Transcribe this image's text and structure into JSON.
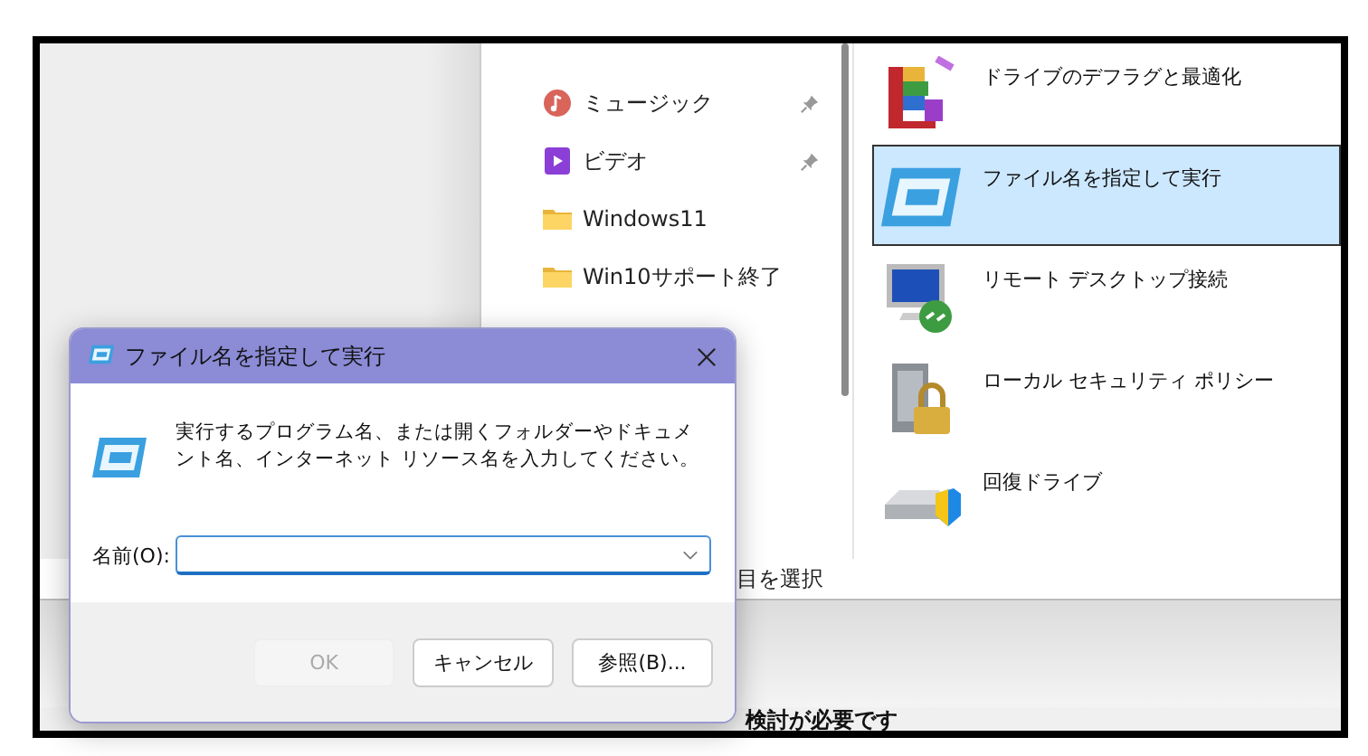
{
  "explorer": {
    "nav_items": [
      {
        "label": "ミュージック",
        "kind": "music",
        "pinned": true
      },
      {
        "label": "ビデオ",
        "kind": "video",
        "pinned": true
      },
      {
        "label": "Windows11",
        "kind": "folder",
        "pinned": false
      },
      {
        "label": "Win10サポート終了",
        "kind": "folder",
        "pinned": false
      }
    ],
    "apps": [
      {
        "label": "ドライブのデフラグと最適化",
        "kind": "defrag",
        "selected": false
      },
      {
        "label": "ファイル名を指定して実行",
        "kind": "run",
        "selected": true
      },
      {
        "label": "リモート デスクトップ接続",
        "kind": "remote",
        "selected": false
      },
      {
        "label": "ローカル セキュリティ ポリシー",
        "kind": "security",
        "selected": false
      },
      {
        "label": "回復ドライブ",
        "kind": "recovery",
        "selected": false
      }
    ],
    "status_text": "目を選択",
    "bottom_text": "検討が必要です"
  },
  "run_dialog": {
    "title": "ファイル名を指定して実行",
    "message": "実行するプログラム名、または開くフォルダーやドキュメント名、インターネット リソース名を入力してください。",
    "name_label": "名前(O):",
    "name_field": {
      "focused": true
    },
    "buttons": [
      {
        "label": "OK",
        "disabled": true
      },
      {
        "label": "キャンセル",
        "disabled": false
      },
      {
        "label": "参照(B)...",
        "disabled": false
      }
    ]
  }
}
